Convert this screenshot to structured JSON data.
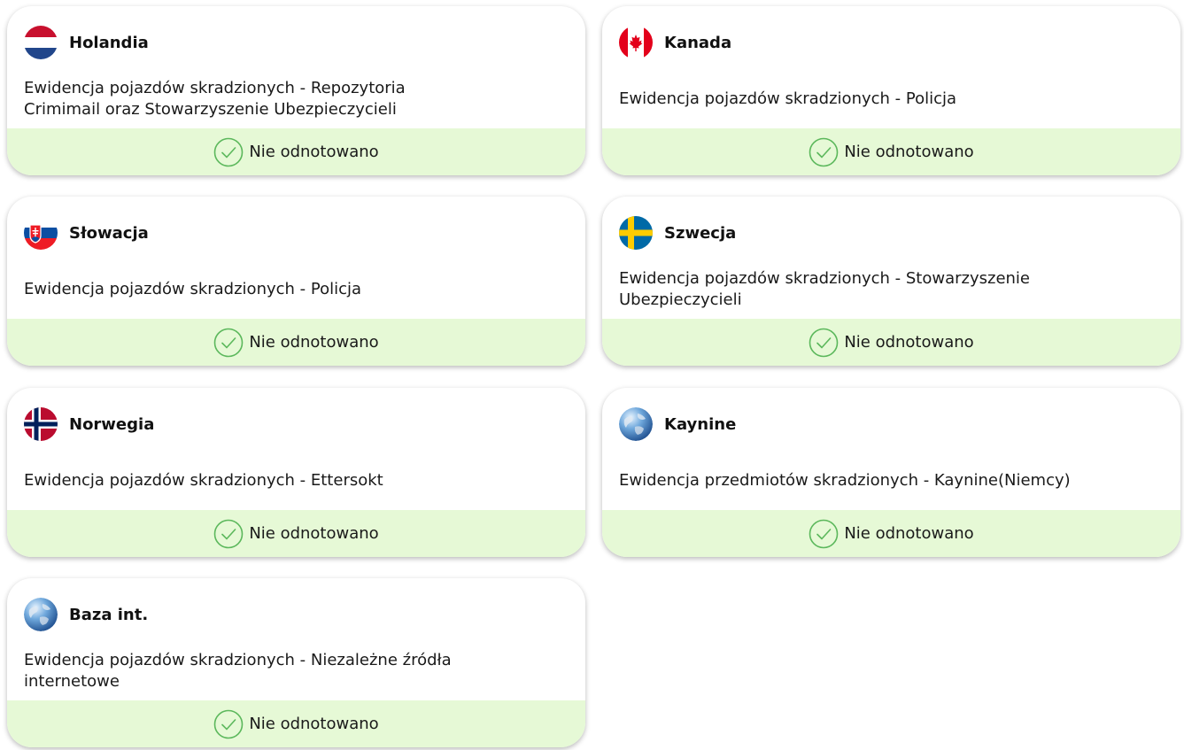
{
  "status_color": "#e6f9d6",
  "check_color": "#5cb85c",
  "cards": [
    {
      "country": "Holandia",
      "flag_icon": "netherlands-flag-icon",
      "description": "Ewidencja pojazdów skradzionych - Repozytoria Crimimail oraz Stowarzyszenie Ubezpieczycieli",
      "status": "Nie odnotowano"
    },
    {
      "country": "Kanada",
      "flag_icon": "canada-flag-icon",
      "description": "Ewidencja pojazdów skradzionych - Policja",
      "status": "Nie odnotowano"
    },
    {
      "country": "Słowacja",
      "flag_icon": "slovakia-flag-icon",
      "description": "Ewidencja pojazdów skradzionych - Policja",
      "status": "Nie odnotowano"
    },
    {
      "country": "Szwecja",
      "flag_icon": "sweden-flag-icon",
      "description": "Ewidencja pojazdów skradzionych - Stowarzyszenie Ubezpieczycieli",
      "status": "Nie odnotowano"
    },
    {
      "country": "Norwegia",
      "flag_icon": "norway-flag-icon",
      "description": "Ewidencja pojazdów skradzionych - Ettersokt",
      "status": "Nie odnotowano"
    },
    {
      "country": "Kaynine",
      "flag_icon": "globe-icon",
      "description": "Ewidencja przedmiotów skradzionych - Kaynine(Niemcy)",
      "status": "Nie odnotowano"
    },
    {
      "country": "Baza int.",
      "flag_icon": "globe-icon",
      "description": "Ewidencja pojazdów skradzionych - Niezależne źródła internetowe",
      "status": "Nie odnotowano"
    }
  ]
}
